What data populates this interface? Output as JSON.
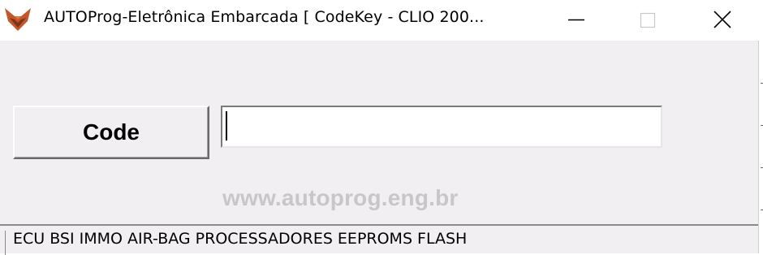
{
  "window": {
    "title": "AUTOProg-Eletrônica Embarcada [ CodeKey - CLIO  200...",
    "icon": "autoprog-fox-logo-icon",
    "controls": {
      "minimize_icon": "minimize-icon",
      "maximize_icon": "maximize-icon",
      "close_icon": "close-icon"
    }
  },
  "main": {
    "code_button_label": "Code",
    "code_input_value": "",
    "website": "www.autoprog.eng.br"
  },
  "statusbar": {
    "text": "ECU BSI IMMO AIR-BAG PROCESSADORES EEPROMS FLASH"
  },
  "colors": {
    "title_bg": "#ffffff",
    "window_bg": "#f2eff2",
    "logo_orange": "#c4572a",
    "watermark_gray": "#c9c6c9"
  }
}
